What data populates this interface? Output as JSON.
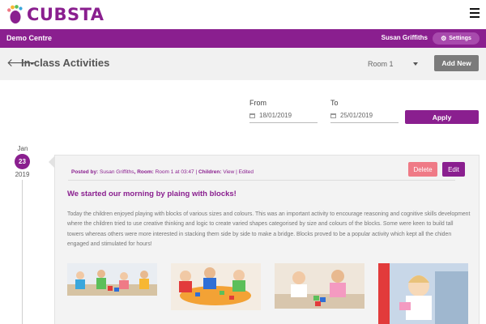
{
  "app": {
    "logo_text": "CUBSTA",
    "brand_color": "#8a1f8f"
  },
  "topbar": {
    "centre_name": "Demo Centre",
    "user_name": "Susan Griffiths",
    "settings_label": "Settings"
  },
  "header": {
    "title": "In-class Activities",
    "room_select_value": "Room 1",
    "add_new_label": "Add New"
  },
  "filter": {
    "from_label": "From",
    "from_value": "18/01/2019",
    "to_label": "To",
    "to_value": "25/01/2019",
    "apply_label": "Apply"
  },
  "timeline": {
    "month": "Jan",
    "day": "23",
    "year": "2019"
  },
  "post": {
    "posted_by_label": "Posted by:",
    "posted_by": "Susan Griffiths",
    "room_label": "Room:",
    "room_time": "Room 1 at 03:47",
    "children_label": "Children:",
    "children_link": "View",
    "edited": "Edited",
    "delete_label": "Delete",
    "edit_label": "Edit",
    "title": "We started our morning by plaing with blocks!",
    "body": "Today the children enjoyed playing with blocks of various sizes and colours. This was an important activity to encourage reasoning and cognitive skills development where the children tried to use creative thinking and logic to create varied shapes categorised by size and colours of the blocks. Some were keen to build tall towers whereas others were more interested in stacking them side by side to make a bridge. Blocks proved to be a popular activity which kept all the chiden engaged and stimulated for hours!",
    "photos": [
      "children-playing-photo-1",
      "children-playing-photo-2",
      "children-playing-photo-3",
      "children-playing-photo-4"
    ]
  }
}
